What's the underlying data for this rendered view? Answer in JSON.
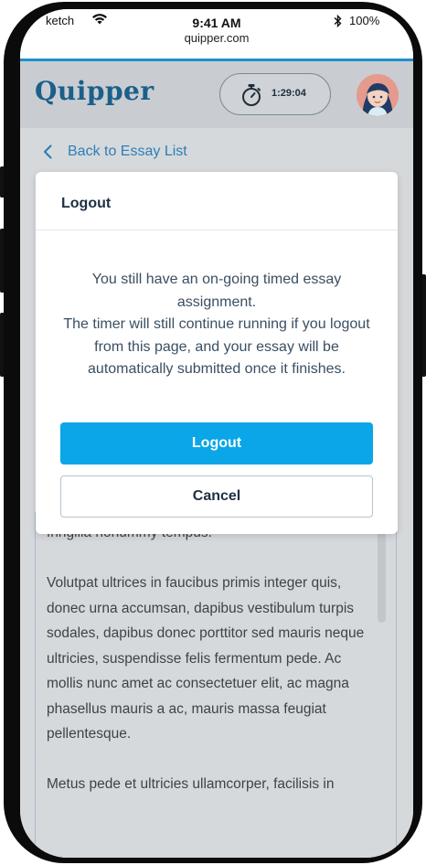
{
  "status_bar": {
    "carrier": "ketch",
    "time": "9:41 AM",
    "url": "quipper.com",
    "battery": "100%"
  },
  "header": {
    "logo": "Quipper",
    "timer": "1:29:04",
    "icons": {
      "timer": "stopwatch-icon",
      "avatar": "user-avatar"
    }
  },
  "nav": {
    "back_label": "Back to Essay List"
  },
  "essay": {
    "paragraphs": [
      "fringilla nonummy tempus.",
      "Volutpat ultrices in faucibus primis integer quis, donec urna accumsan, dapibus vestibulum turpis sodales, dapibus donec porttitor sed mauris neque ultricies, suspendisse felis fermentum pede. Ac mollis nunc amet ac consectetuer elit, ac magna phasellus mauris a ac, mauris massa feugiat pellentesque.",
      "Metus pede et ultricies ullamcorper, facilisis in"
    ]
  },
  "modal": {
    "title": "Logout",
    "message_line1": "You still have an on-going timed essay assignment.",
    "message_line2": "The timer will still continue running if you logout from this page, and your essay will be automatically submitted once it finishes.",
    "primary_label": "Logout",
    "secondary_label": "Cancel"
  },
  "colors": {
    "accent": "#0aa6e8",
    "brand": "#1b5f8a",
    "link": "#2c7fb6",
    "overlay_dim": "#d6d9dc"
  }
}
